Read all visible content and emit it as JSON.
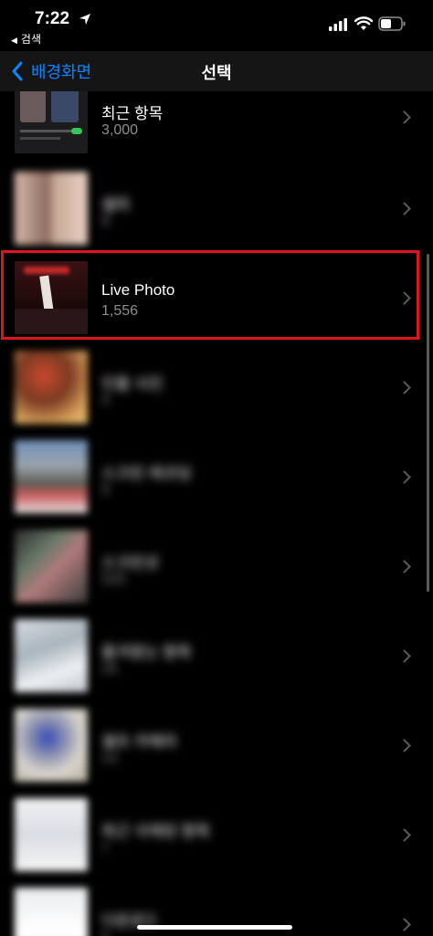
{
  "status": {
    "time": "7:22",
    "back_app_label": "검색"
  },
  "nav": {
    "back_label": "배경화면",
    "title": "선택"
  },
  "albums": [
    {
      "label": "최근 항목",
      "count": "3,000"
    },
    {
      "label": "셀피",
      "count": "8"
    },
    {
      "label": "Live Photo",
      "count": "1,556"
    },
    {
      "label": "인물 사진",
      "count": "4"
    },
    {
      "label": "스크린 레코딩",
      "count": "9"
    },
    {
      "label": "스크린샷",
      "count": "520"
    },
    {
      "label": "즐겨찾는 항목",
      "count": "26"
    },
    {
      "label": "셀프 카메라",
      "count": "14"
    },
    {
      "label": "최근 삭제된 항목",
      "count": "7"
    },
    {
      "label": "다운로드",
      "count": "5"
    }
  ],
  "colors": {
    "accent": "#0a84ff",
    "highlight_border": "#e0141c",
    "background": "#000000",
    "secondary_text": "#8e8e93"
  }
}
